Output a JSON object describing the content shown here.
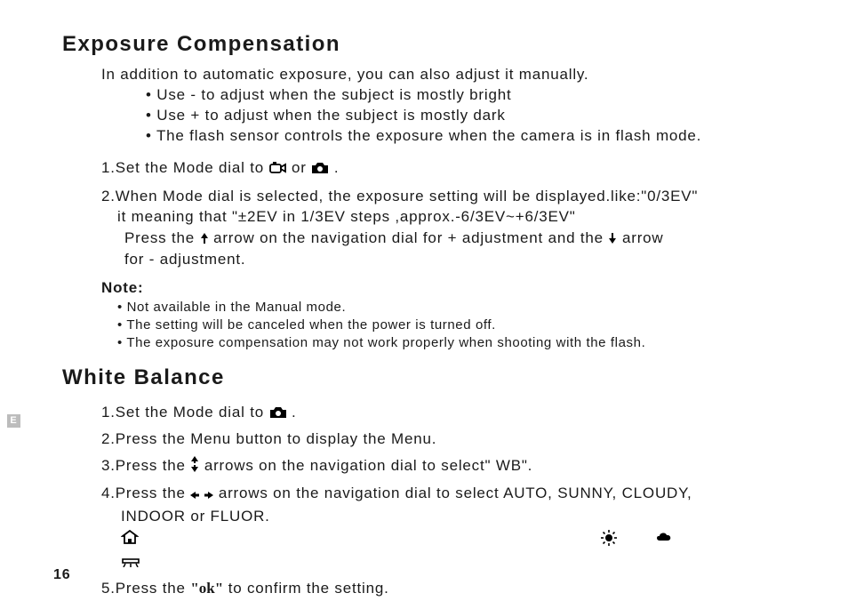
{
  "section1": {
    "heading": "Exposure Compensation",
    "intro": "In addition to automatic exposure, you can also adjust it manually.",
    "bullets": [
      "Use - to adjust when the subject is mostly bright",
      "Use + to adjust when the subject is mostly dark",
      "The flash sensor controls the exposure when the camera is in flash mode."
    ],
    "step1_a": "1.Set the Mode dial to ",
    "step1_b": " or ",
    "step1_c": " .",
    "step2_line1": "2.When Mode dial is selected, the exposure setting will be displayed.like:\"0/3EV\"",
    "step2_line2": "it meaning that \"±2EV in 1/3EV steps ,approx.-6/3EV~+6/3EV\"",
    "step2_line3a": "Press the ",
    "step2_line3b": " arrow on the navigation dial for + adjustment and the ",
    "step2_line3c": " arrow",
    "step2_line4": "for - adjustment.",
    "note_head": "Note:",
    "notes": [
      "Not available in the Manual mode.",
      "The setting will be canceled when the power is turned  off.",
      "The exposure compensation may not work properly when shooting with the flash."
    ]
  },
  "section2": {
    "heading": "White Balance",
    "step1_a": "1.Set the Mode dial to ",
    "step1_b": ".",
    "step2": "2.Press the Menu button to display the Menu.",
    "step3_a": "3.Press the  ",
    "step3_b": "  arrows on the navigation dial to select\" WB\".",
    "step4_a": "4.Press the  ",
    "step4_b": "  arrows on the navigation dial to select AUTO, SUNNY, CLOUDY,",
    "step4_c": "INDOOR or  FLUOR.",
    "step5_a": "5.Press the ",
    "step5_ok": "\"ok\"",
    "step5_b": "  to confirm the setting."
  },
  "page_number": "16",
  "side_tab": "E"
}
